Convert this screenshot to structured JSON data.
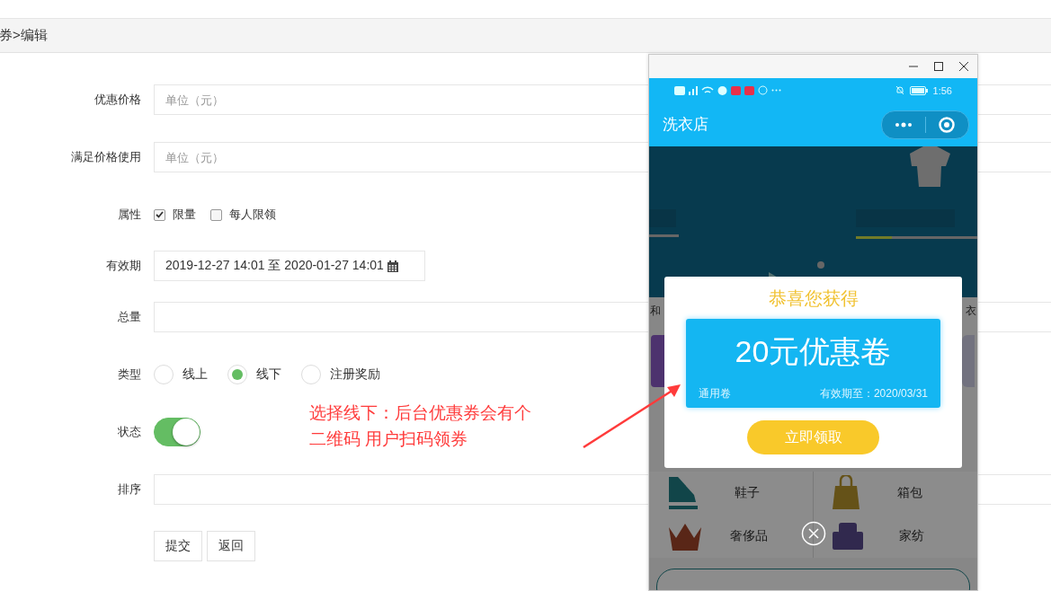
{
  "breadcrumb": "券>编辑",
  "form": {
    "fields": [
      {
        "kind": "input",
        "label": "优惠价格",
        "placeholder": "单位（元）"
      },
      {
        "kind": "input",
        "label": "满足价格使用",
        "placeholder": "单位（元）"
      },
      {
        "kind": "checkboxes",
        "label": "属性",
        "options": [
          {
            "label": "限量",
            "checked": true
          },
          {
            "label": "每人限领",
            "checked": false
          }
        ]
      },
      {
        "kind": "date",
        "label": "有效期",
        "value": "2019-12-27 14:01 至 2020-01-27 14:01"
      },
      {
        "kind": "input",
        "label": "总量"
      },
      {
        "kind": "radios",
        "label": "类型",
        "options": [
          {
            "label": "线上",
            "selected": false
          },
          {
            "label": "线下",
            "selected": true
          },
          {
            "label": "注册奖励",
            "selected": false
          }
        ]
      },
      {
        "kind": "switch",
        "label": "状态",
        "on": true
      },
      {
        "kind": "input",
        "label": "排序"
      }
    ],
    "buttons": [
      "提交",
      "返回"
    ]
  },
  "annotation": {
    "lines": [
      "选择线下：后台优惠券会有个",
      "二维码 用户扫码领券"
    ]
  },
  "phone": {
    "status_time": "1:56",
    "title": "洗衣店",
    "side_texts": [
      "和",
      "衣"
    ],
    "categories": [
      {
        "label": "鞋子"
      },
      {
        "label": "箱包"
      },
      {
        "label": "奢侈品"
      },
      {
        "label": "家纺"
      }
    ],
    "popup": {
      "title": "恭喜您获得",
      "amount": "20元优惠卷",
      "type": "通用卷",
      "expiry": "有效期至：2020/03/31",
      "button": "立即领取"
    }
  }
}
